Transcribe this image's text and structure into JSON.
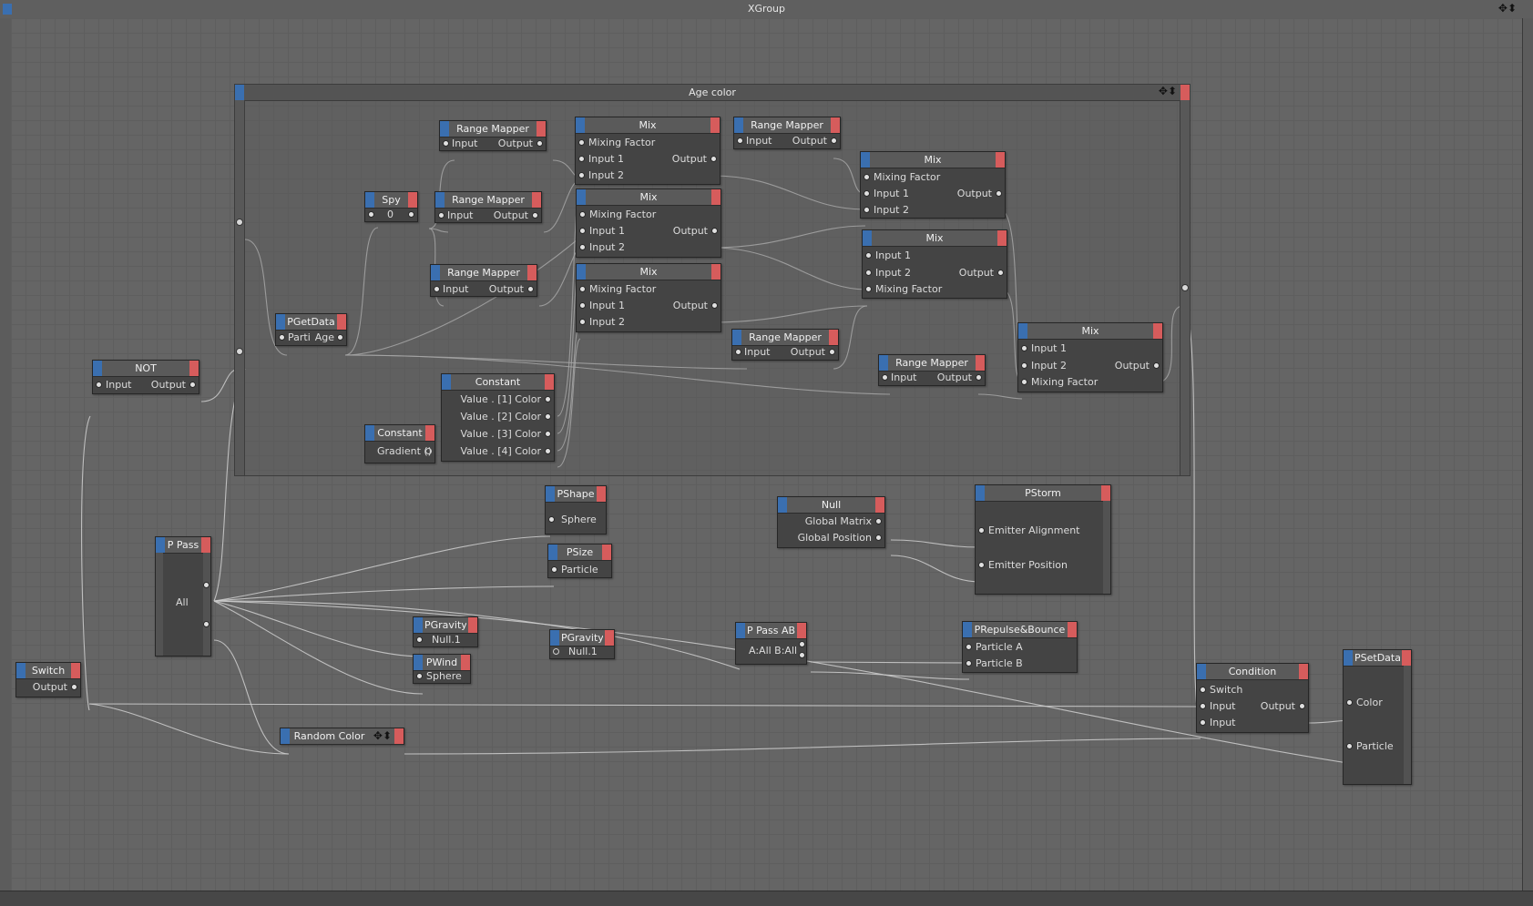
{
  "window": {
    "title": "XGroup"
  },
  "group": {
    "title": "Age color"
  },
  "nodes": {
    "rm1": {
      "title": "Range Mapper",
      "in": "Input",
      "out": "Output"
    },
    "rm2": {
      "title": "Range Mapper",
      "in": "Input",
      "out": "Output"
    },
    "rm3": {
      "title": "Range Mapper",
      "in": "Input",
      "out": "Output"
    },
    "rm4": {
      "title": "Range Mapper",
      "in": "Input",
      "out": "Output"
    },
    "rm5": {
      "title": "Range Mapper",
      "in": "Input",
      "out": "Output"
    },
    "rm6": {
      "title": "Range Mapper",
      "in": "Input",
      "out": "Output"
    },
    "spy": {
      "title": "Spy",
      "value": "0"
    },
    "pgetdata": {
      "title": "PGetData",
      "in": "Partic",
      "out": "Age"
    },
    "mix1": {
      "title": "Mix",
      "p1": "Mixing Factor",
      "p2": "Input 1",
      "p3": "Input 2",
      "out": "Output"
    },
    "mix2": {
      "title": "Mix",
      "p1": "Mixing Factor",
      "p2": "Input 1",
      "p3": "Input 2",
      "out": "Output"
    },
    "mix3": {
      "title": "Mix",
      "p1": "Mixing Factor",
      "p2": "Input 1",
      "p3": "Input 2",
      "out": "Output"
    },
    "mix4": {
      "title": "Mix",
      "p1": "Mixing Factor",
      "p2": "Input 1",
      "p3": "Input 2",
      "out": "Output"
    },
    "mix5": {
      "title": "Mix",
      "p1": "Input 1",
      "p2": "Input 2",
      "p3": "Mixing Factor",
      "out": "Output"
    },
    "mix6": {
      "title": "Mix",
      "p1": "Input 1",
      "p2": "Input 2",
      "p3": "Mixing Factor",
      "out": "Output"
    },
    "const1": {
      "title": "Constant",
      "v1": "Value . [1] Color",
      "v2": "Value . [2] Color",
      "v3": "Value . [3] Color",
      "v4": "Value . [4] Color"
    },
    "const2": {
      "title": "Constant",
      "v1": "Gradient ()"
    },
    "not": {
      "title": "NOT",
      "in": "Input",
      "out": "Output"
    },
    "ppass": {
      "title": "P Pass",
      "body": "All"
    },
    "switch": {
      "title": "Switch",
      "out": "Output"
    },
    "randomcolor": {
      "title": "Random Color"
    },
    "pshape": {
      "title": "PShape",
      "p1": "Sphere"
    },
    "psize": {
      "title": "PSize",
      "p1": "Particle"
    },
    "pgravity1": {
      "title": "PGravity",
      "p1": "Null.1"
    },
    "pwind": {
      "title": "PWind",
      "p1": "Sphere"
    },
    "pgravity2": {
      "title": "PGravity",
      "p1": "Null.1"
    },
    "ppassab": {
      "title": "P Pass AB",
      "body": "A:All B:All"
    },
    "null": {
      "title": "Null",
      "p1": "Global Matrix",
      "p2": "Global Position"
    },
    "pstorm": {
      "title": "PStorm",
      "p1": "Emitter Alignment",
      "p2": "Emitter Position"
    },
    "prepulse": {
      "title": "PRepulse&Bounce",
      "p1": "Particle A",
      "p2": "Particle B"
    },
    "condition": {
      "title": "Condition",
      "p1": "Switch",
      "p2": "Input",
      "p3": "Input",
      "out": "Output"
    },
    "psetdata": {
      "title": "PSetData",
      "p1": "Color",
      "p2": "Particle"
    }
  },
  "icons": {
    "window_controls": "move-resize-icon",
    "group_controls": "move-resize-icon"
  },
  "colors": {
    "port_in": "#3a6fb0",
    "port_out": "#d65c5c",
    "node_body": "#444444",
    "canvas": "#656565"
  }
}
